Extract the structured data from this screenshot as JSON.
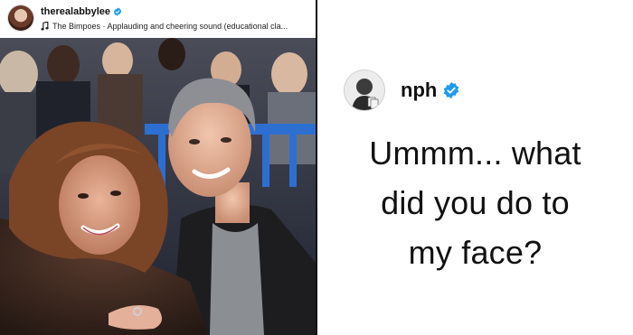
{
  "post": {
    "username": "therealabbylee",
    "audio": "The Bimpoes · Applauding and cheering sound (educational cla...",
    "verified": true
  },
  "comment": {
    "username": "nph",
    "verified": true,
    "lines": [
      "Ummm... what",
      "did you do to",
      "my face?"
    ]
  },
  "colors": {
    "verified_badge": "#1d9bf0",
    "text": "#111111",
    "divider": "#111111"
  },
  "icons": {
    "music": "music-note-icon",
    "verified": "verified-badge-icon"
  }
}
